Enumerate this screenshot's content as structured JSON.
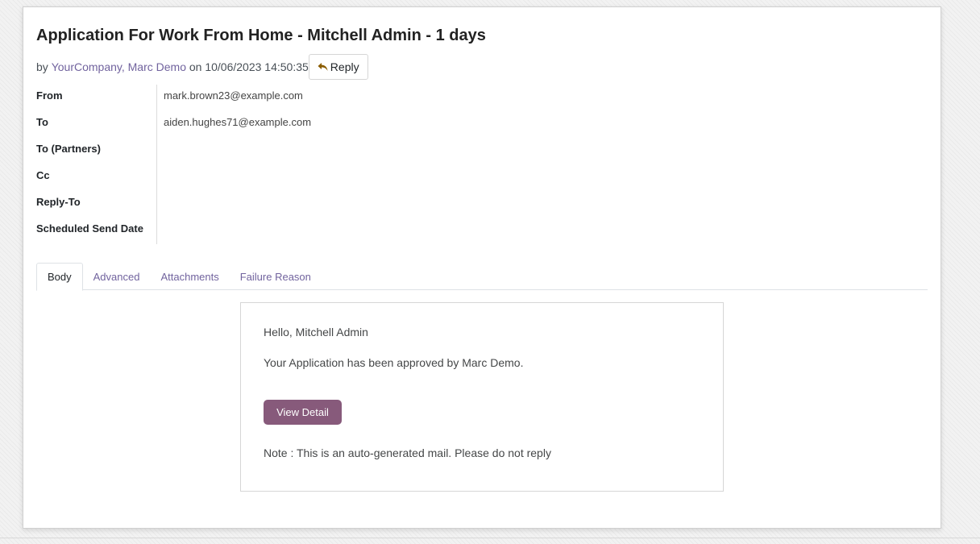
{
  "header": {
    "title": "Application For Work From Home - Mitchell Admin - 1 days",
    "by_prefix": "by",
    "authors": "YourCompany, Marc Demo",
    "on_text": "on 10/06/2023 14:50:35",
    "reply_label": "Reply"
  },
  "fields": [
    {
      "label": "From",
      "value": "mark.brown23@example.com"
    },
    {
      "label": "To",
      "value": "aiden.hughes71@example.com"
    },
    {
      "label": "To (Partners)",
      "value": ""
    },
    {
      "label": "Cc",
      "value": ""
    },
    {
      "label": "Reply-To",
      "value": ""
    },
    {
      "label": "Scheduled Send Date",
      "value": ""
    }
  ],
  "tabs": [
    {
      "label": "Body",
      "active": true
    },
    {
      "label": "Advanced",
      "active": false
    },
    {
      "label": "Attachments",
      "active": false
    },
    {
      "label": "Failure Reason",
      "active": false
    }
  ],
  "body": {
    "greeting": "Hello, Mitchell Admin",
    "message": "Your Application has been approved by Marc Demo.",
    "button_label": "View Detail",
    "note": "Note : This is an auto-generated mail. Please do not reply"
  },
  "colors": {
    "link": "#71639e",
    "primary_button": "#875a7b",
    "reply_icon": "#8a5c00"
  }
}
